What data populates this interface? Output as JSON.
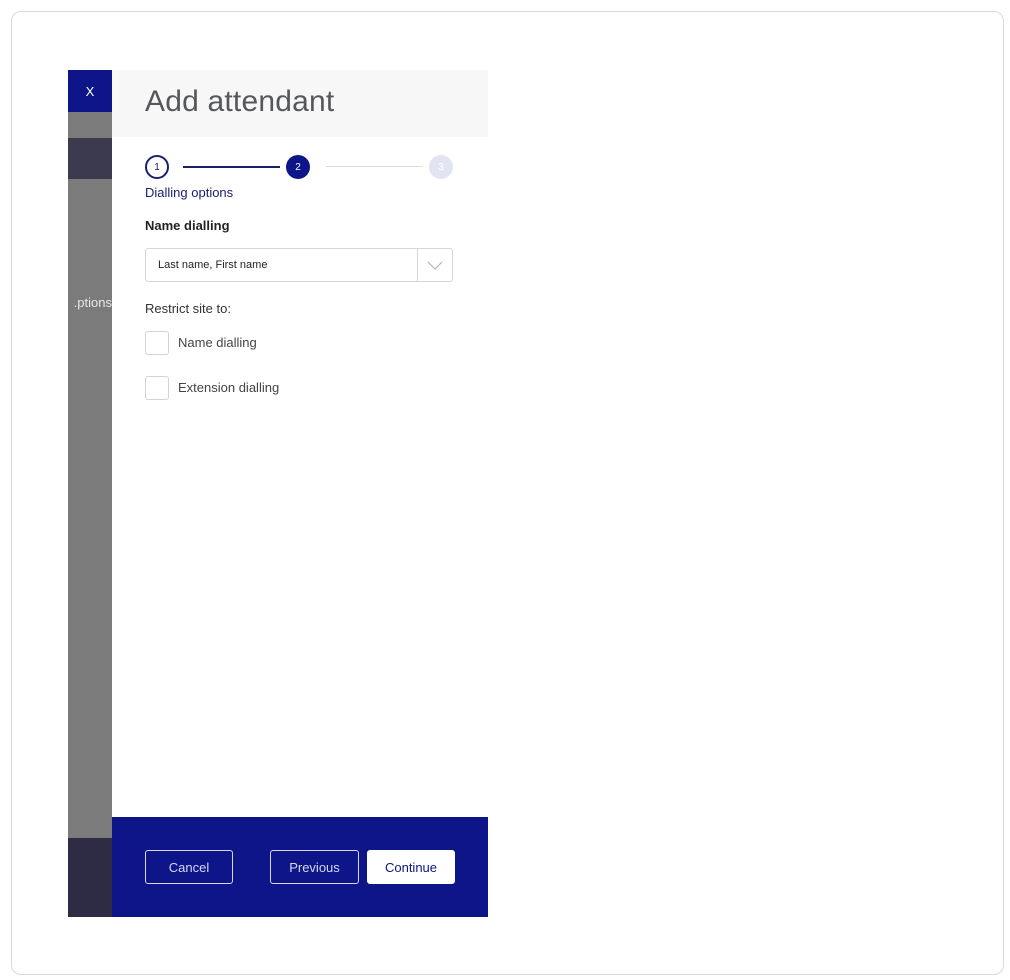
{
  "dialog": {
    "close_label": "X",
    "background_text": "ptions.",
    "title": "Add attendant"
  },
  "stepper": {
    "steps": [
      "1",
      "2",
      "3"
    ],
    "current_step": 2,
    "current_label": "Dialling options"
  },
  "form": {
    "name_dialling_label": "Name dialling",
    "name_dialling_value": "Last name, First name",
    "restrict_label": "Restrict site to:",
    "checkboxes": [
      {
        "label": "Name dialling",
        "checked": false
      },
      {
        "label": "Extension dialling",
        "checked": false
      }
    ]
  },
  "footer": {
    "cancel_label": "Cancel",
    "previous_label": "Previous",
    "continue_label": "Continue"
  },
  "colors": {
    "brand": "#0d1589",
    "step_text": "#1a2070",
    "inactive_step": "#e2e4f2"
  }
}
